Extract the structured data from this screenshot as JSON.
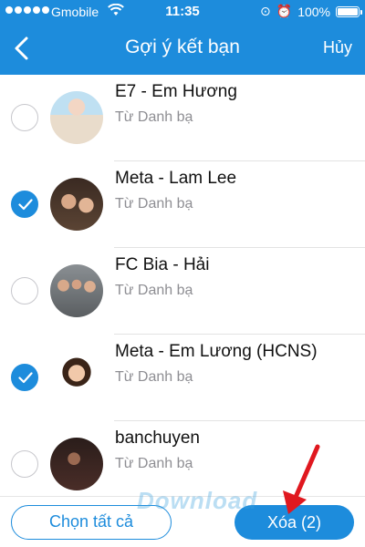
{
  "status_bar": {
    "carrier": "Gmobile",
    "time": "11:35",
    "battery": "100%",
    "battery_level": 1.0
  },
  "nav": {
    "title": "Gợi ý kết bạn",
    "cancel_label": "Hủy"
  },
  "contacts": [
    {
      "name": "E7 - Em Hương",
      "source": "Từ Danh bạ",
      "selected": false
    },
    {
      "name": "Meta - Lam Lee",
      "source": "Từ Danh bạ",
      "selected": true
    },
    {
      "name": "FC Bia - Hải",
      "source": "Từ Danh bạ",
      "selected": false
    },
    {
      "name": "Meta - Em Lương (HCNS)",
      "source": "Từ Danh bạ",
      "selected": true
    },
    {
      "name": "banchuyen",
      "source": "Từ Danh bạ",
      "selected": false
    }
  ],
  "bottom": {
    "select_all_label": "Chọn tất cả",
    "delete_label": "Xóa (2)"
  },
  "watermark": "Download",
  "colors": {
    "accent": "#1d8cdc",
    "annotation_arrow": "#e0181f"
  }
}
